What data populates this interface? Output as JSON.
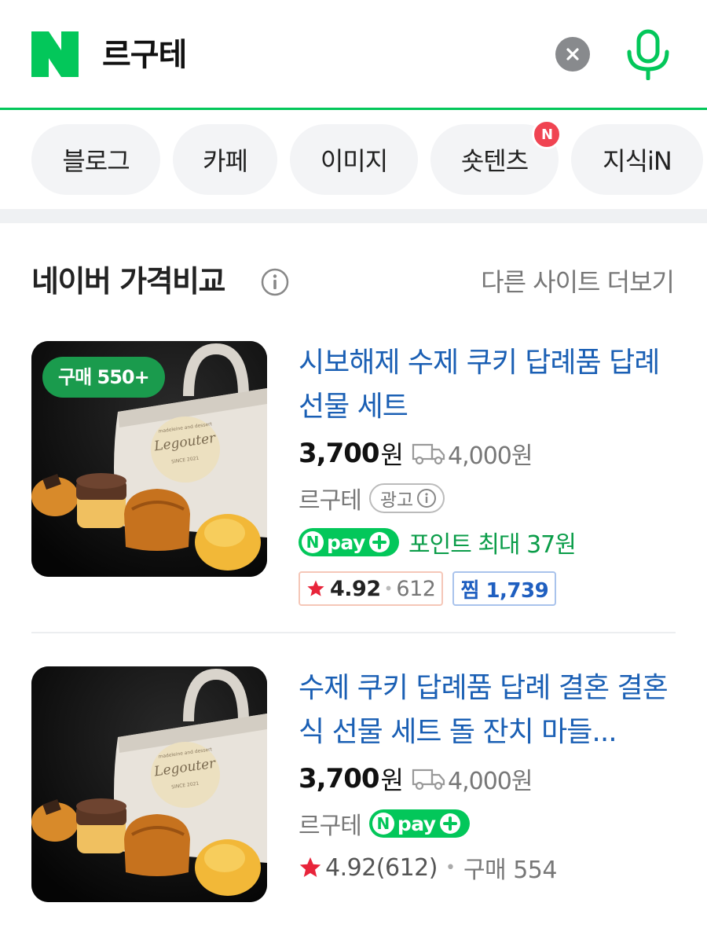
{
  "search": {
    "query": "르구테"
  },
  "tabs": [
    {
      "label": "블로그",
      "new": false
    },
    {
      "label": "카페",
      "new": false
    },
    {
      "label": "이미지",
      "new": false
    },
    {
      "label": "숏텐츠",
      "new": true
    },
    {
      "label": "지식iN",
      "new": false
    }
  ],
  "new_badge": "N",
  "section": {
    "title": "네이버 가격비교",
    "more_link": "다른 사이트 더보기"
  },
  "products": [
    {
      "badge": "구매 550+",
      "title": "시보해제 수제 쿠키 답례품 답례 선물 세트",
      "price": "3,700",
      "price_unit": "원",
      "delivery": "4,000원",
      "seller": "르구테",
      "ad_label": "광고",
      "npay_text": "pay",
      "point_text": "포인트 최대 37원",
      "rating": "4.92",
      "rating_count": "612",
      "like_label": "찜 1,739"
    },
    {
      "title": "수제 쿠키 답례품 답례 결혼 결혼식 선물 세트 돌 잔치 마들...",
      "price": "3,700",
      "price_unit": "원",
      "delivery": "4,000원",
      "seller": "르구테",
      "npay_text": "pay",
      "review": "4.92(612)",
      "purchase": "구매 554"
    }
  ],
  "thumbnail": {
    "brand_script": "Legouter",
    "brand_sub": "madeleine and dessert",
    "since": "SINCE 2021"
  },
  "colors": {
    "naver_green": "#03c75a",
    "title_blue": "#1a5fb4",
    "badge_red": "#f04452",
    "star_red": "#e8243a"
  },
  "icons": {
    "clear": "close-circle-icon",
    "mic": "microphone-icon",
    "info": "info-circle-icon",
    "truck": "delivery-truck-icon",
    "star": "star-icon"
  }
}
